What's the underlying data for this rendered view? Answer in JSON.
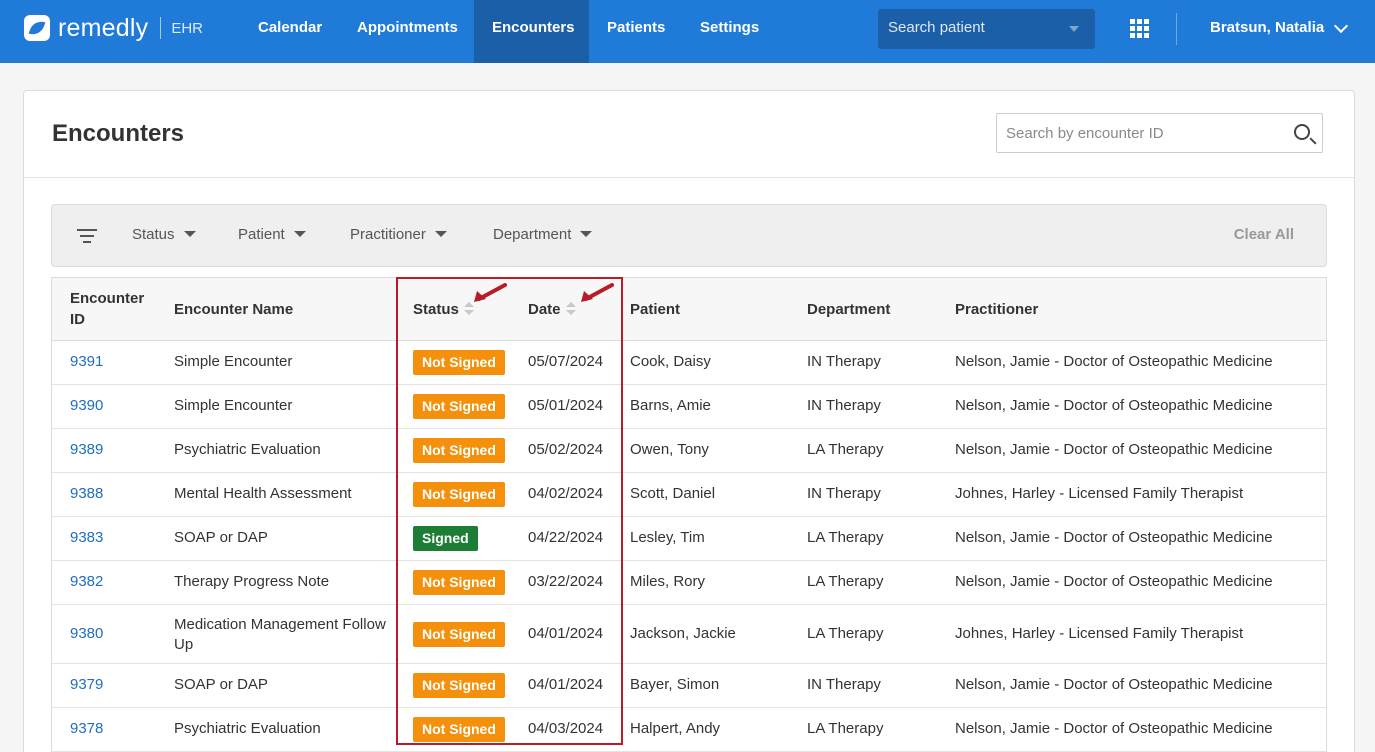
{
  "nav": {
    "logo_text": "remedly",
    "logo_suffix": "EHR",
    "items": [
      {
        "label": "Calendar"
      },
      {
        "label": "Appointments"
      },
      {
        "label": "Encounters"
      },
      {
        "label": "Patients"
      },
      {
        "label": "Settings"
      }
    ],
    "active": "Encounters",
    "search_placeholder": "Search patient",
    "user_name": "Bratsun, Natalia"
  },
  "page": {
    "title": "Encounters",
    "search_placeholder": "Search by encounter ID"
  },
  "filters": {
    "items": [
      {
        "label": "Status"
      },
      {
        "label": "Patient"
      },
      {
        "label": "Practitioner"
      },
      {
        "label": "Department"
      }
    ],
    "clear_label": "Clear All"
  },
  "table": {
    "columns": {
      "id": "Encounter ID",
      "name": "Encounter Name",
      "status": "Status",
      "date": "Date",
      "patient": "Patient",
      "department": "Department",
      "practitioner": "Practitioner"
    },
    "rows": [
      {
        "id": "9391",
        "name": "Simple Encounter",
        "status": "Not Signed",
        "date": "05/07/2024",
        "patient": "Cook, Daisy",
        "department": "IN Therapy",
        "practitioner": "Nelson, Jamie - Doctor of Osteopathic Medicine"
      },
      {
        "id": "9390",
        "name": "Simple Encounter",
        "status": "Not Signed",
        "date": "05/01/2024",
        "patient": "Barns, Amie",
        "department": "IN Therapy",
        "practitioner": "Nelson, Jamie - Doctor of Osteopathic Medicine"
      },
      {
        "id": "9389",
        "name": "Psychiatric Evaluation",
        "status": "Not Signed",
        "date": "05/02/2024",
        "patient": "Owen, Tony",
        "department": "LA Therapy",
        "practitioner": "Nelson, Jamie - Doctor of Osteopathic Medicine"
      },
      {
        "id": "9388",
        "name": "Mental Health Assessment",
        "status": "Not Signed",
        "date": "04/02/2024",
        "patient": "Scott, Daniel",
        "department": "IN Therapy",
        "practitioner": "Johnes, Harley - Licensed Family Therapist"
      },
      {
        "id": "9383",
        "name": "SOAP or DAP",
        "status": "Signed",
        "date": "04/22/2024",
        "patient": "Lesley, Tim",
        "department": "LA Therapy",
        "practitioner": "Nelson, Jamie - Doctor of Osteopathic Medicine"
      },
      {
        "id": "9382",
        "name": "Therapy Progress Note",
        "status": "Not Signed",
        "date": "03/22/2024",
        "patient": "Miles, Rory",
        "department": "LA Therapy",
        "practitioner": "Nelson, Jamie - Doctor of Osteopathic Medicine"
      },
      {
        "id": "9380",
        "name": "Medication Management Follow Up",
        "status": "Not Signed",
        "date": "04/01/2024",
        "patient": "Jackson, Jackie",
        "department": "LA Therapy",
        "practitioner": "Johnes, Harley - Licensed Family Therapist"
      },
      {
        "id": "9379",
        "name": "SOAP or DAP",
        "status": "Not Signed",
        "date": "04/01/2024",
        "patient": "Bayer, Simon",
        "department": "IN Therapy",
        "practitioner": "Nelson, Jamie - Doctor of Osteopathic Medicine"
      },
      {
        "id": "9378",
        "name": "Psychiatric Evaluation",
        "status": "Not Signed",
        "date": "04/03/2024",
        "patient": "Halpert, Andy",
        "department": "LA Therapy",
        "practitioner": "Nelson, Jamie - Doctor of Osteopathic Medicine"
      }
    ]
  },
  "colors": {
    "nav_bg": "#1f7ad8",
    "nav_active": "#1a5fa8",
    "not_signed": "#f4900c",
    "signed": "#1e7d35",
    "link": "#1f6fbf",
    "annotation": "#b81c28"
  }
}
